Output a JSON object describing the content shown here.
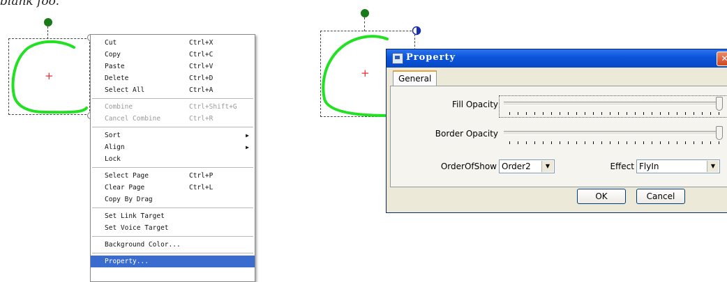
{
  "top_partial_text": "blank foo.",
  "left_shape": {
    "center_marker": "+"
  },
  "right_shape": {
    "center_marker": "+"
  },
  "context_menu": {
    "groups": [
      [
        {
          "label": "Cut",
          "shortcut": "Ctrl+X"
        },
        {
          "label": "Copy",
          "shortcut": "Ctrl+C"
        },
        {
          "label": "Paste",
          "shortcut": "Ctrl+V"
        },
        {
          "label": "Delete",
          "shortcut": "Ctrl+D"
        },
        {
          "label": "Select All",
          "shortcut": "Ctrl+A"
        }
      ],
      [
        {
          "label": "Combine",
          "shortcut": "Ctrl+Shift+G",
          "disabled": true
        },
        {
          "label": "Cancel Combine",
          "shortcut": "Ctrl+R",
          "disabled": true
        }
      ],
      [
        {
          "label": "Sort",
          "submenu": true
        },
        {
          "label": "Align",
          "submenu": true
        },
        {
          "label": "Lock"
        }
      ],
      [
        {
          "label": "Select Page",
          "shortcut": "Ctrl+P"
        },
        {
          "label": "Clear Page",
          "shortcut": "Ctrl+L"
        },
        {
          "label": "Copy By Drag"
        }
      ],
      [
        {
          "label": "Set Link Target"
        },
        {
          "label": "Set Voice Target"
        }
      ],
      [
        {
          "label": "Background Color..."
        }
      ],
      [
        {
          "label": "Property...",
          "selected": true
        }
      ]
    ],
    "submenu_arrow": "▶",
    "selected_color": "#3a6ccf"
  },
  "dialog": {
    "title": "Property",
    "close_glyph": "✕",
    "tab_label": "General",
    "fill_opacity_label": "Fill Opacity",
    "fill_opacity_value": 1.0,
    "border_opacity_label": "Border Opacity",
    "border_opacity_value": 1.0,
    "order_label": "OrderOfShow",
    "order_value": "Order2",
    "effect_label": "Effect",
    "effect_value": "FlyIn",
    "combo_arrow": "▼",
    "ok_label": "OK",
    "cancel_label": "Cancel",
    "title_color": "#0a53d8"
  }
}
